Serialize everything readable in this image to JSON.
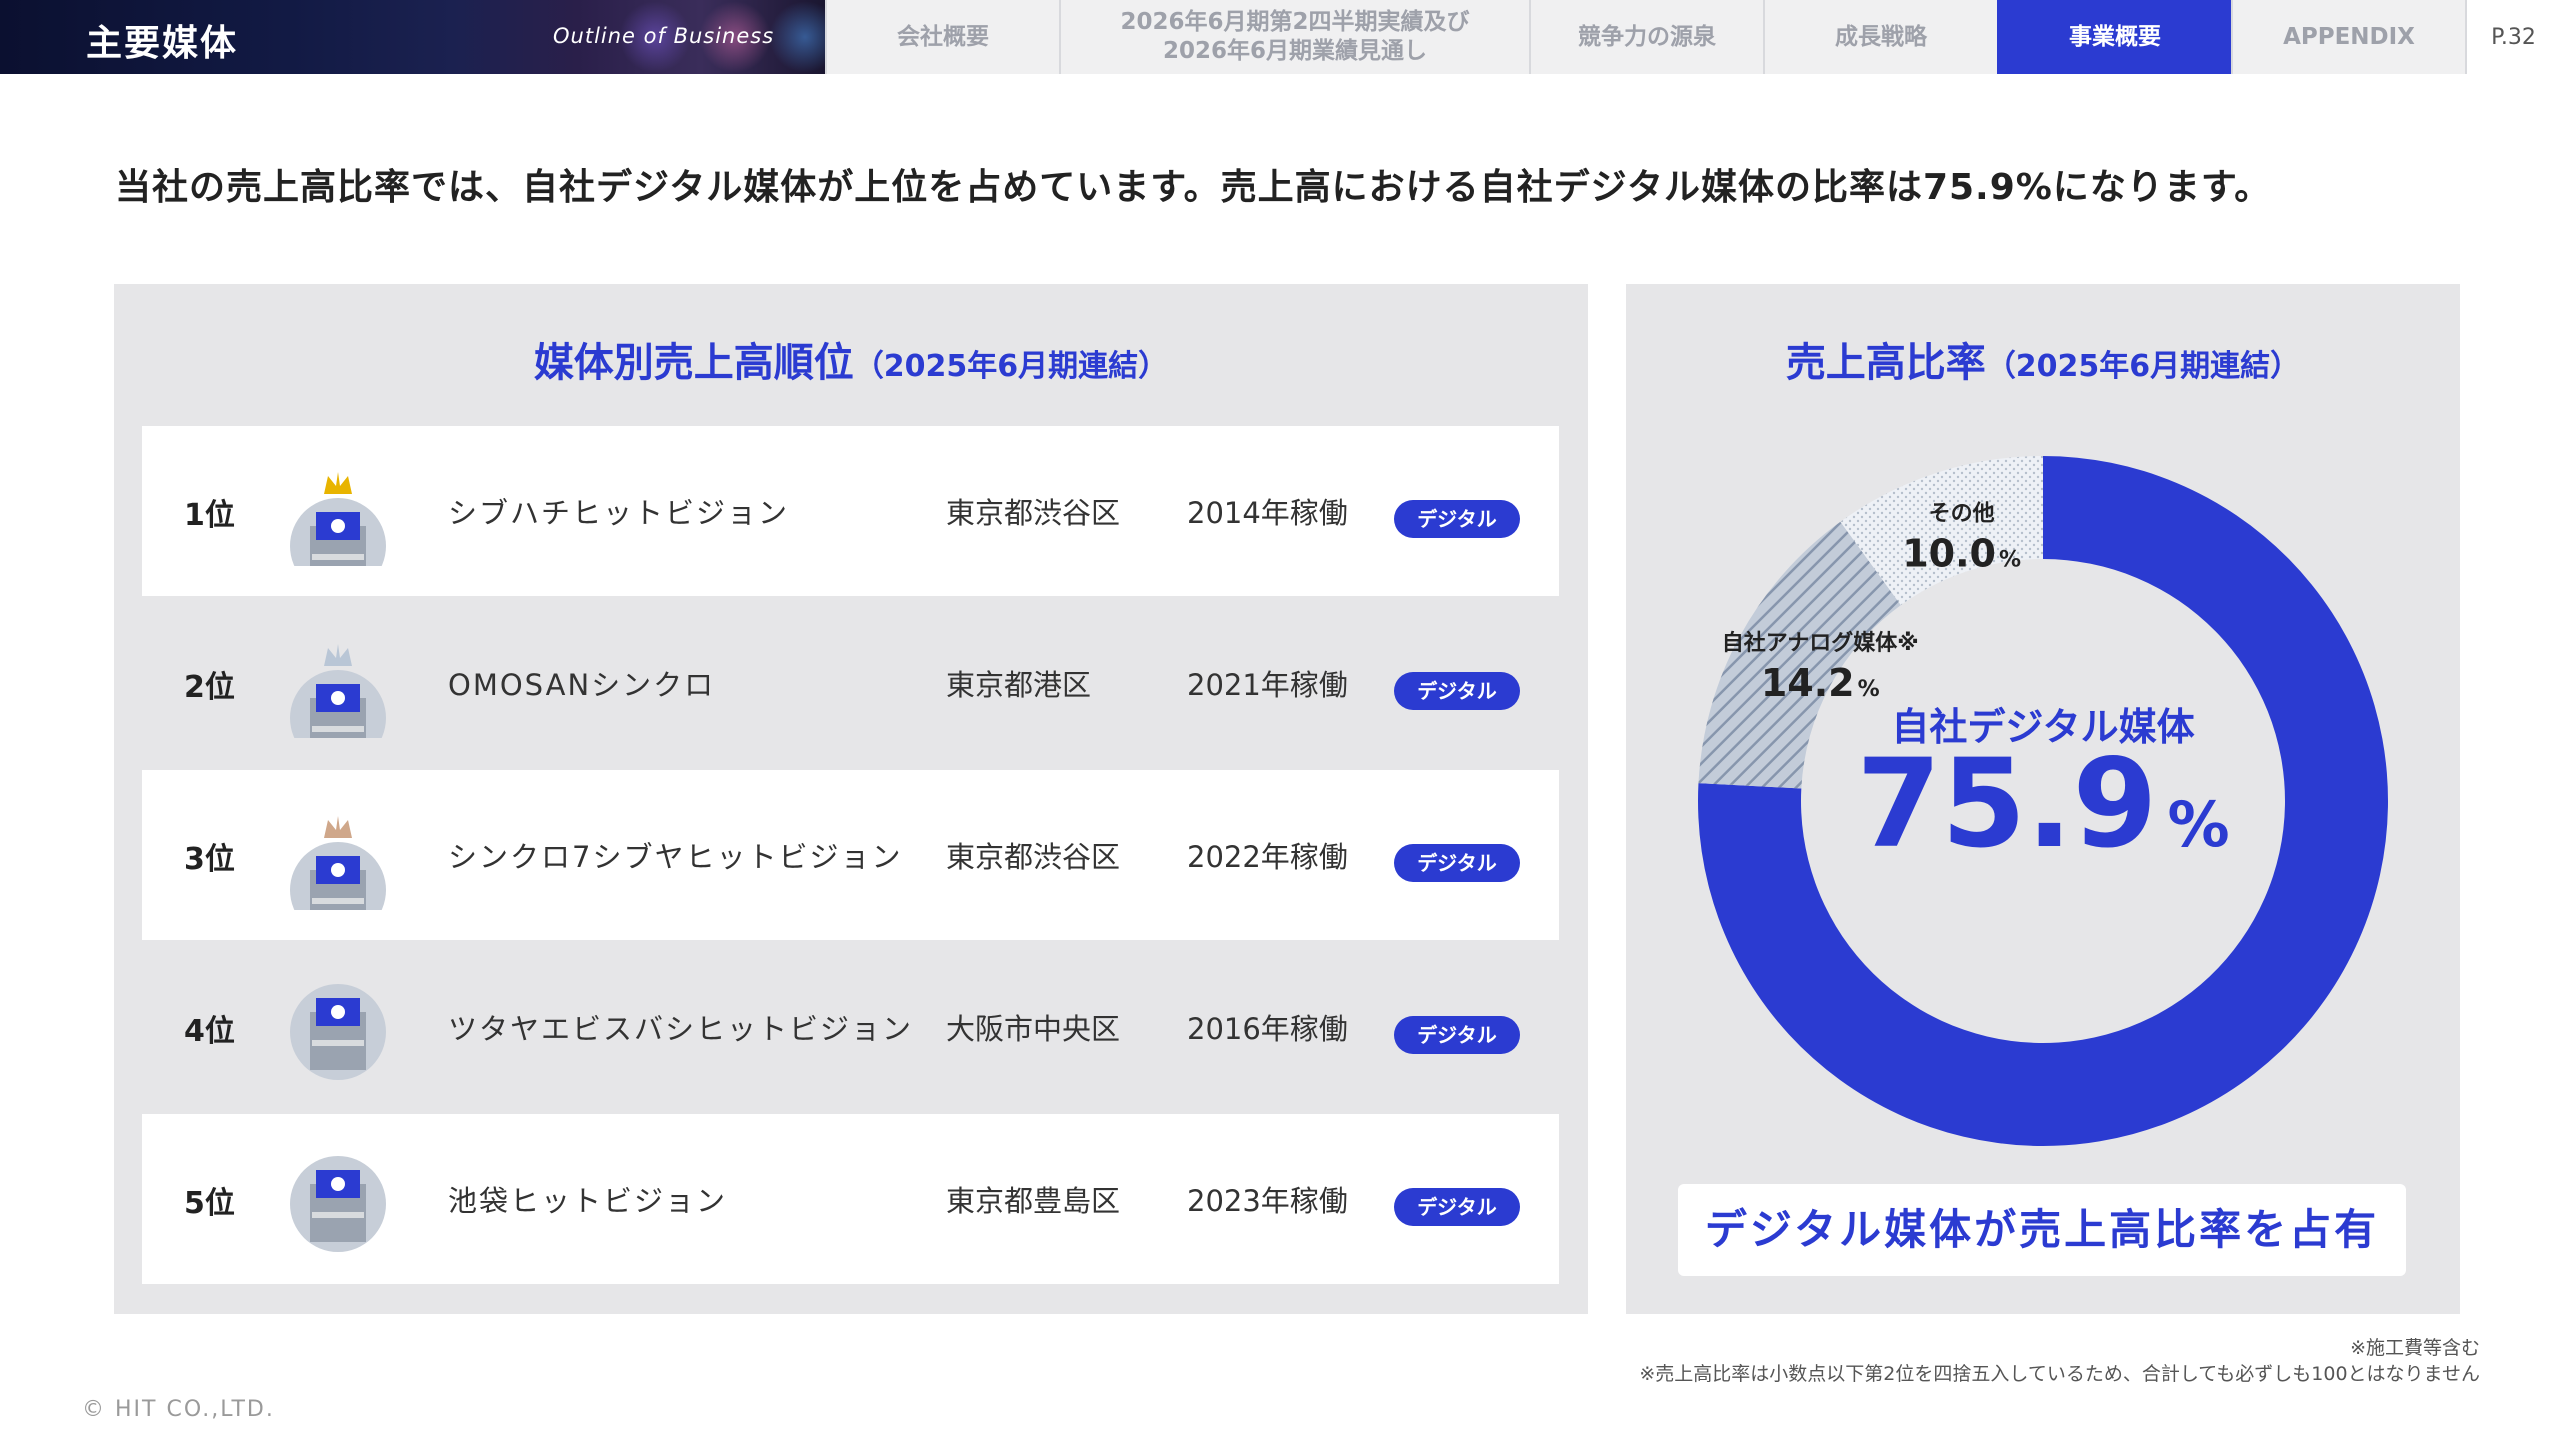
{
  "header": {
    "section_title": "主要媒体",
    "section_subtitle": "Outline of Business",
    "tabs": [
      {
        "label": "会社概要",
        "active": false
      },
      {
        "label": "2026年6月期第2四半期実績及び\n2026年6月期業績見通し",
        "active": false
      },
      {
        "label": "競争力の源泉",
        "active": false
      },
      {
        "label": "成長戦略",
        "active": false
      },
      {
        "label": "事業概要",
        "active": true
      },
      {
        "label": "APPENDIX",
        "active": false
      }
    ],
    "page_number": "P.32"
  },
  "headline": "当社の売上高比率では、自社デジタル媒体が上位を占めています。売上高における自社デジタル媒体の比率は75.9%になります。",
  "ranking": {
    "title": "媒体別売上高順位",
    "period": "（2025年6月期連結）",
    "rows": [
      {
        "rank": "1位",
        "name": "シブハチヒットビジョン",
        "location": "東京都渋谷区",
        "year": "2014年稼働",
        "badge": "デジタル",
        "crown": "gold"
      },
      {
        "rank": "2位",
        "name": "OMOSANシンクロ",
        "location": "東京都港区",
        "year": "2021年稼働",
        "badge": "デジタル",
        "crown": "silver"
      },
      {
        "rank": "3位",
        "name": "シンクロ7シブヤヒットビジョン",
        "location": "東京都渋谷区",
        "year": "2022年稼働",
        "badge": "デジタル",
        "crown": "bronze"
      },
      {
        "rank": "4位",
        "name": "ツタヤエビスバシヒットビジョン",
        "location": "大阪市中央区",
        "year": "2016年稼働",
        "badge": "デジタル",
        "crown": ""
      },
      {
        "rank": "5位",
        "name": "池袋ヒットビジョン",
        "location": "東京都豊島区",
        "year": "2023年稼働",
        "badge": "デジタル",
        "crown": ""
      }
    ]
  },
  "chart_data": {
    "type": "pie",
    "title": "売上高比率",
    "subtitle": "（2025年6月期連結）",
    "unit": "%",
    "categories": [
      "自社デジタル媒体",
      "自社アナログ媒体※",
      "その他"
    ],
    "values": [
      75.9,
      14.2,
      10.0
    ],
    "labels": [
      "75.9",
      "14.2",
      "10.0"
    ],
    "colors": [
      "#2b3bd1",
      "#a9b4c6",
      "#e3e7ee"
    ],
    "center_label": "自社デジタル媒体",
    "center_value": "75.9"
  },
  "caption": "デジタル媒体が売上高比率を占有",
  "footnotes": {
    "note1": "※施工費等含む",
    "note2": "※売上高比率は小数点以下第2位を四捨五入しているため、合計しても必ずしも100とはなりません"
  },
  "copyright": "© HIT CO.,LTD."
}
